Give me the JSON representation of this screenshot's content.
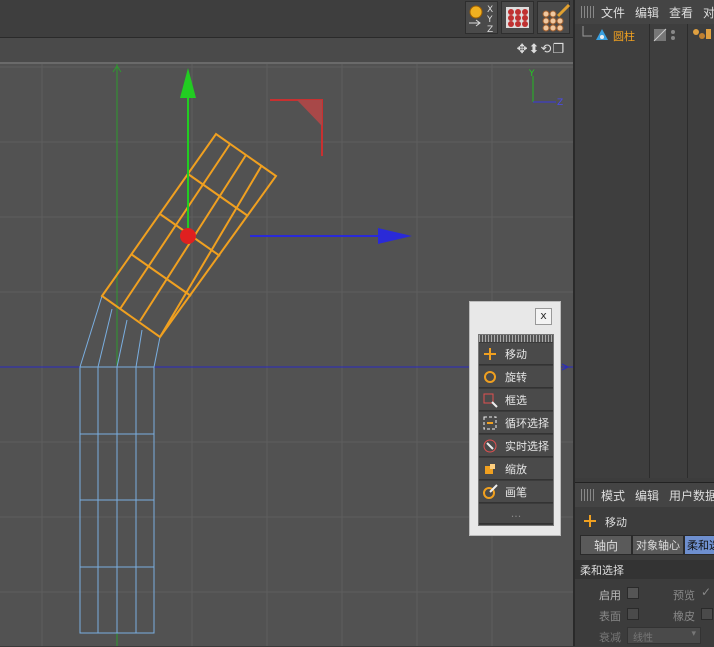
{
  "toolbar": {
    "axis_labels": [
      "X",
      "Y",
      "Z"
    ],
    "icons": [
      "world-axis-icon",
      "render-grid-icon",
      "paint-grid-icon"
    ]
  },
  "viewport": {
    "header_icons": [
      "move-view-icon",
      "pan-view-icon",
      "orbit-view-icon",
      "maximize-view-icon"
    ],
    "axis_gizmo": {
      "y": "Y",
      "z": "Z"
    }
  },
  "object_manager": {
    "menu": [
      "文件",
      "编辑",
      "查看",
      "对"
    ],
    "object_name": "圆柱"
  },
  "attributes": {
    "menu": [
      "模式",
      "编辑",
      "用户数据"
    ],
    "tool_name": "移动",
    "tabs": [
      "轴向",
      "对象轴心",
      "柔和选"
    ],
    "section_title": "柔和选择",
    "fields": {
      "enable_label": "启用",
      "preview_label": "预览",
      "preview_check": "✓",
      "surface_label": "表面",
      "rubber_label": "橡皮",
      "falloff_label": "衰减",
      "falloff_value": "线性"
    }
  },
  "palette": {
    "close": "x",
    "items": [
      {
        "label": "移动",
        "icon": "move-icon"
      },
      {
        "label": "旋转",
        "icon": "rotate-icon"
      },
      {
        "label": "框选",
        "icon": "box-select-icon"
      },
      {
        "label": "循环选择",
        "icon": "loop-select-icon"
      },
      {
        "label": "实时选择",
        "icon": "live-select-icon"
      },
      {
        "label": "缩放",
        "icon": "scale-icon"
      },
      {
        "label": "画笔",
        "icon": "brush-icon"
      }
    ],
    "extra": "..."
  },
  "colors": {
    "selection": "#f0a020",
    "wire": "#7aaee0",
    "x_axis": "#2a2ad8",
    "y_axis": "#22cc22",
    "handle": "#e02020"
  }
}
